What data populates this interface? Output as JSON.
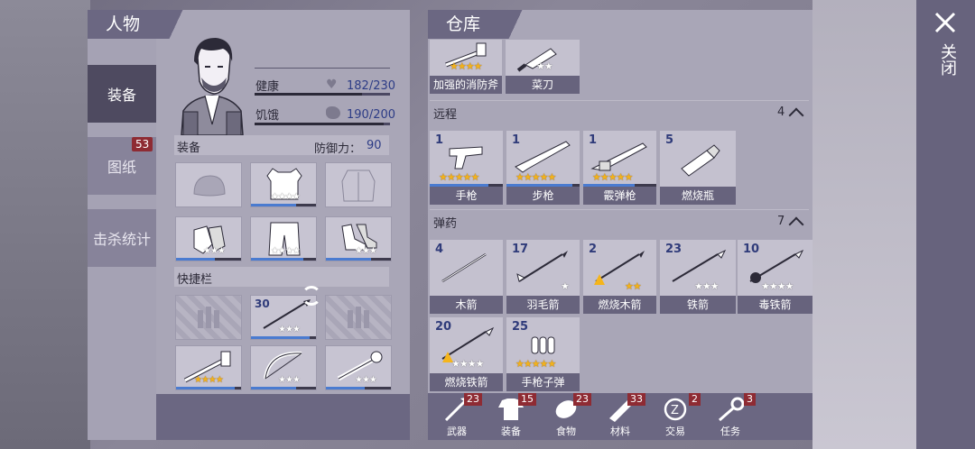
{
  "character": {
    "title": "人物",
    "tabs": [
      {
        "label": "装备",
        "active": true
      },
      {
        "label": "图纸",
        "badge": "53"
      },
      {
        "label": "击杀统计"
      }
    ],
    "stats": {
      "health": {
        "label": "健康",
        "value": "182/230",
        "fraction": 0.79
      },
      "hunger": {
        "label": "饥饿",
        "value": "190/200",
        "fraction": 0.95
      }
    },
    "equipment": {
      "label": "装备",
      "defense_label": "防御力：",
      "defense_value": "90"
    },
    "equip_slots": [
      {
        "name": "helmet",
        "stars": 0,
        "durability": 0
      },
      {
        "name": "body-armor",
        "stars": 4,
        "durability": 0.7
      },
      {
        "name": "jacket",
        "stars": 0,
        "durability": 0
      },
      {
        "name": "gloves",
        "stars": 3,
        "durability": 0.6
      },
      {
        "name": "pants",
        "stars": 4,
        "durability": 0.8
      },
      {
        "name": "boots",
        "stars": 3,
        "durability": 0.7
      }
    ],
    "quickbar": {
      "label": "快捷栏",
      "slots": [
        {
          "name": "empty",
          "empty": true
        },
        {
          "name": "spear",
          "count": "30",
          "stars": 3,
          "durability": 0.9
        },
        {
          "name": "empty",
          "empty": true
        },
        {
          "name": "reinforced-fire-axe",
          "stars": 4,
          "gold": true,
          "durability": 0.9
        },
        {
          "name": "bow",
          "stars": 3,
          "durability": 0.7
        },
        {
          "name": "pipe-wrench",
          "stars": 3,
          "durability": 0.6
        }
      ]
    }
  },
  "warehouse": {
    "title": "仓库",
    "top_items": [
      {
        "label": "加强的消防斧",
        "stars": 4,
        "gold": true
      },
      {
        "label": "菜刀",
        "stars": 2,
        "gold": false
      }
    ],
    "ranged": {
      "label": "远程",
      "count": "4",
      "items": [
        {
          "label": "手枪",
          "count": "1",
          "stars": 5,
          "gold": true,
          "durability": 0.8
        },
        {
          "label": "步枪",
          "count": "1",
          "stars": 5,
          "gold": true,
          "durability": 0.9
        },
        {
          "label": "霰弹枪",
          "count": "1",
          "stars": 5,
          "gold": true,
          "durability": 0.7
        },
        {
          "label": "燃烧瓶",
          "count": "5",
          "stars": 0,
          "gold": false,
          "durability": 0
        }
      ]
    },
    "ammo": {
      "label": "弹药",
      "count": "7",
      "items": [
        {
          "label": "木箭",
          "count": "4",
          "stars": 0
        },
        {
          "label": "羽毛箭",
          "count": "17",
          "stars": 1,
          "gold": false
        },
        {
          "label": "燃烧木箭",
          "count": "2",
          "stars": 2,
          "gold": true,
          "fire": true
        },
        {
          "label": "铁箭",
          "count": "23",
          "stars": 3,
          "gold": false
        },
        {
          "label": "毒铁箭",
          "count": "10",
          "stars": 4,
          "gold": false,
          "poison": true
        },
        {
          "label": "燃烧铁箭",
          "count": "20",
          "stars": 4,
          "gold": false,
          "fire": true
        },
        {
          "label": "手枪子弹",
          "count": "25",
          "stars": 5,
          "gold": true
        }
      ]
    },
    "categories": [
      {
        "label": "武器",
        "badge": "23",
        "icon": "axe-icon"
      },
      {
        "label": "装备",
        "badge": "15",
        "icon": "shirt-icon"
      },
      {
        "label": "食物",
        "badge": "23",
        "icon": "food-icon"
      },
      {
        "label": "材料",
        "badge": "33",
        "icon": "material-icon"
      },
      {
        "label": "交易",
        "badge": "2",
        "icon": "trade-icon"
      },
      {
        "label": "任务",
        "badge": "3",
        "icon": "key-icon"
      }
    ]
  },
  "close": {
    "label": "关闭"
  }
}
